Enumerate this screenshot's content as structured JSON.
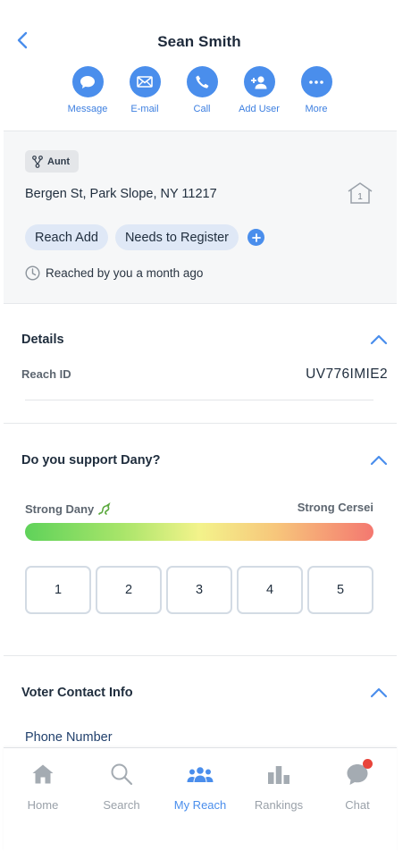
{
  "header": {
    "title": "Sean Smith",
    "actions": [
      {
        "label": "Message",
        "icon": "chat-bubble-icon"
      },
      {
        "label": "E-mail",
        "icon": "envelope-icon"
      },
      {
        "label": "Call",
        "icon": "phone-icon"
      },
      {
        "label": "Add User",
        "icon": "add-user-icon"
      },
      {
        "label": "More",
        "icon": "ellipsis-icon"
      }
    ]
  },
  "contact": {
    "relationship": "Aunt",
    "address": "Bergen St, Park Slope, NY 11217",
    "household_count": "1",
    "tags": [
      "Reach Add",
      "Needs to Register"
    ],
    "reached_text": "Reached by you a month ago"
  },
  "details": {
    "title": "Details",
    "reach_id_label": "Reach ID",
    "reach_id_value": "UV776IMIE2"
  },
  "support": {
    "title": "Do you support Dany?",
    "left_label": "Strong Dany",
    "right_label": "Strong Cersei",
    "options": [
      "1",
      "2",
      "3",
      "4",
      "5"
    ]
  },
  "voter_contact": {
    "title": "Voter Contact Info",
    "phone_label": "Phone Number"
  },
  "tabbar": {
    "tabs": [
      {
        "label": "Home",
        "icon": "home-icon"
      },
      {
        "label": "Search",
        "icon": "search-icon"
      },
      {
        "label": "My Reach",
        "icon": "people-icon"
      },
      {
        "label": "Rankings",
        "icon": "bar-chart-icon"
      },
      {
        "label": "Chat",
        "icon": "chat-icon"
      }
    ],
    "active": "My Reach"
  },
  "colors": {
    "accent": "#4a8eec",
    "chip_bg": "#dfe8f6",
    "info_bg": "#f6f7f8",
    "notification": "#e8443a"
  }
}
